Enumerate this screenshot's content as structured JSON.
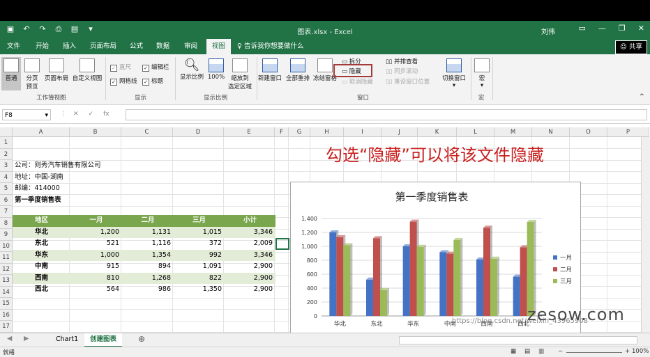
{
  "window": {
    "title": "图表.xlsx - Excel",
    "user": "刘伟"
  },
  "tabs": [
    "文件",
    "开始",
    "插入",
    "页面布局",
    "公式",
    "数据",
    "审阅",
    "视图"
  ],
  "tell_me": "告诉我你想要做什么",
  "share_label": "共享",
  "ribbon": {
    "normal": "普通",
    "page_break_l1": "分页",
    "page_break_l2": "预览",
    "page_layout": "页面布局",
    "custom_view": "自定义视图",
    "group_workbook_views": "工作簿视图",
    "ruler": "直尺",
    "formula_bar": "编辑栏",
    "gridlines": "网格线",
    "headings": "标题",
    "group_show": "显示",
    "zoom": "显示比例",
    "zoom_100": "100%",
    "zoom_sel_l1": "缩放到",
    "zoom_sel_l2": "选定区域",
    "group_zoom": "显示比例",
    "new_window": "新建窗口",
    "arrange_all": "全部重排",
    "freeze": "冻结窗格",
    "split": "拆分",
    "hide": "隐藏",
    "unhide": "取消隐藏",
    "side_by_side": "并排查看",
    "sync_scroll": "同步滚动",
    "reset_pos": "重设窗口位置",
    "switch_windows": "切换窗口",
    "group_window": "窗口",
    "macros": "宏",
    "group_macros": "宏"
  },
  "name_box": "F8",
  "formula_icons": [
    "⋮",
    "✕",
    "✓",
    "fx"
  ],
  "columns": [
    "A",
    "B",
    "C",
    "D",
    "E",
    "F",
    "G",
    "H",
    "I",
    "J",
    "K",
    "L",
    "M",
    "N",
    "O",
    "P"
  ],
  "rows": [
    "1",
    "2",
    "3",
    "4",
    "5",
    "6",
    "7",
    "8",
    "9",
    "10",
    "11",
    "12",
    "13",
    "14",
    "15",
    "16",
    "17"
  ],
  "info": {
    "company": "公司：则秀汽车销售有限公司",
    "address": "地址：中国-湖南",
    "postcode": "邮编：414000",
    "sheet_title": "第一季度销售表"
  },
  "table": {
    "headers": [
      "地区",
      "一月",
      "二月",
      "三月",
      "小计"
    ],
    "rows": [
      [
        "华北",
        "1,200",
        "1,131",
        "1,015",
        "3,346"
      ],
      [
        "东北",
        "521",
        "1,116",
        "372",
        "2,009"
      ],
      [
        "华东",
        "1,000",
        "1,354",
        "992",
        "3,346"
      ],
      [
        "中南",
        "915",
        "894",
        "1,091",
        "2,900"
      ],
      [
        "西南",
        "810",
        "1,268",
        "822",
        "2,900"
      ],
      [
        "西北",
        "564",
        "986",
        "1,350",
        "2,900"
      ]
    ]
  },
  "overlay_text": "勾选“隐藏”可以将该文件隐藏",
  "chart_data": {
    "type": "bar",
    "title": "第一季度销售表",
    "categories": [
      "华北",
      "东北",
      "华东",
      "中南",
      "西南",
      "西北"
    ],
    "series": [
      {
        "name": "一月",
        "color": "#4472c4",
        "values": [
          1200,
          521,
          1000,
          915,
          810,
          564
        ]
      },
      {
        "name": "二月",
        "color": "#c0504d",
        "values": [
          1131,
          1116,
          1354,
          894,
          1268,
          986
        ]
      },
      {
        "name": "三月",
        "color": "#9bbb59",
        "values": [
          1015,
          372,
          992,
          1091,
          822,
          1350
        ]
      }
    ],
    "ylim": [
      0,
      1400
    ],
    "yticks": [
      "0",
      "200",
      "400",
      "600",
      "800",
      "1,000",
      "1,200",
      "1,400"
    ],
    "grid": true,
    "legend": "right"
  },
  "sheets": [
    "Chart1",
    "创建图表"
  ],
  "active_sheet": "创建图表",
  "status": {
    "ready": "就绪",
    "zoom": "100%"
  },
  "watermark": "zesow.com",
  "csdn": "https://blog.csdn.net/weixin_43965908"
}
